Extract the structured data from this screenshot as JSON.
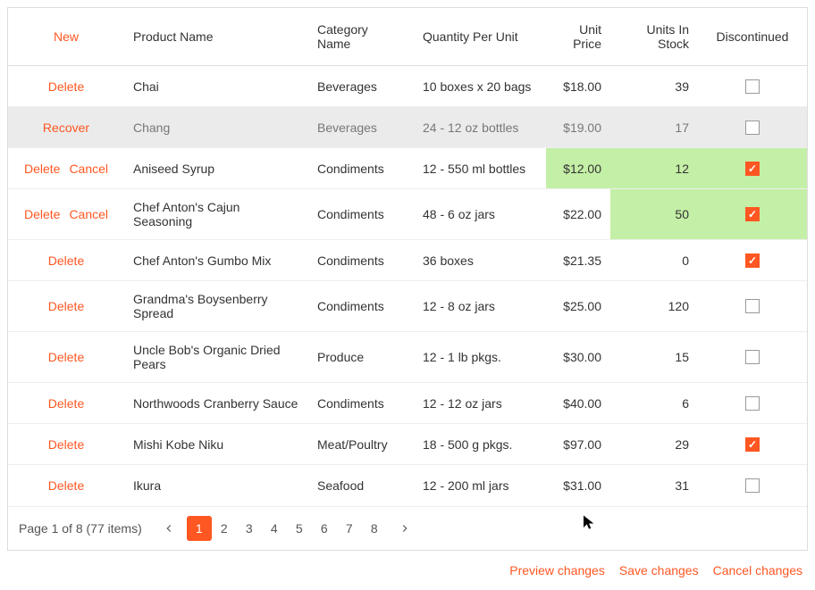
{
  "header": {
    "new": "New",
    "columns": [
      "Product Name",
      "Category Name",
      "Quantity Per Unit",
      "Unit Price",
      "Units In Stock",
      "Discontinued"
    ]
  },
  "actions": {
    "delete": "Delete",
    "cancel": "Cancel",
    "recover": "Recover"
  },
  "rows": [
    {
      "act": [
        "delete"
      ],
      "name": "Chai",
      "cat": "Beverages",
      "qpu": "10 boxes x 20 bags",
      "price": "$18.00",
      "stock": "39",
      "disc": false,
      "state": ""
    },
    {
      "act": [
        "recover"
      ],
      "name": "Chang",
      "cat": "Beverages",
      "qpu": "24 - 12 oz bottles",
      "price": "$19.00",
      "stock": "17",
      "disc": false,
      "state": "deleted"
    },
    {
      "act": [
        "delete",
        "cancel"
      ],
      "name": "Aniseed Syrup",
      "cat": "Condiments",
      "qpu": "12 - 550 ml bottles",
      "price": "$12.00",
      "stock": "12",
      "disc": true,
      "state": "",
      "changed": [
        "price",
        "stock",
        "disc"
      ]
    },
    {
      "act": [
        "delete",
        "cancel"
      ],
      "name": "Chef Anton's Cajun Seasoning",
      "cat": "Condiments",
      "qpu": "48 - 6 oz jars",
      "price": "$22.00",
      "stock": "50",
      "disc": true,
      "state": "",
      "changed": [
        "stock",
        "disc"
      ]
    },
    {
      "act": [
        "delete"
      ],
      "name": "Chef Anton's Gumbo Mix",
      "cat": "Condiments",
      "qpu": "36 boxes",
      "price": "$21.35",
      "stock": "0",
      "disc": true,
      "state": ""
    },
    {
      "act": [
        "delete"
      ],
      "name": "Grandma's Boysenberry Spread",
      "cat": "Condiments",
      "qpu": "12 - 8 oz jars",
      "price": "$25.00",
      "stock": "120",
      "disc": false,
      "state": ""
    },
    {
      "act": [
        "delete"
      ],
      "name": "Uncle Bob's Organic Dried Pears",
      "cat": "Produce",
      "qpu": "12 - 1 lb pkgs.",
      "price": "$30.00",
      "stock": "15",
      "disc": false,
      "state": ""
    },
    {
      "act": [
        "delete"
      ],
      "name": "Northwoods Cranberry Sauce",
      "cat": "Condiments",
      "qpu": "12 - 12 oz jars",
      "price": "$40.00",
      "stock": "6",
      "disc": false,
      "state": ""
    },
    {
      "act": [
        "delete"
      ],
      "name": "Mishi Kobe Niku",
      "cat": "Meat/Poultry",
      "qpu": "18 - 500 g pkgs.",
      "price": "$97.00",
      "stock": "29",
      "disc": true,
      "state": ""
    },
    {
      "act": [
        "delete"
      ],
      "name": "Ikura",
      "cat": "Seafood",
      "qpu": "12 - 200 ml jars",
      "price": "$31.00",
      "stock": "31",
      "disc": false,
      "state": ""
    }
  ],
  "pager": {
    "info": "Page 1 of 8 (77 items)",
    "pages": [
      "1",
      "2",
      "3",
      "4",
      "5",
      "6",
      "7",
      "8"
    ],
    "current": "1"
  },
  "footer": {
    "preview": "Preview changes",
    "save": "Save changes",
    "cancel": "Cancel changes"
  }
}
